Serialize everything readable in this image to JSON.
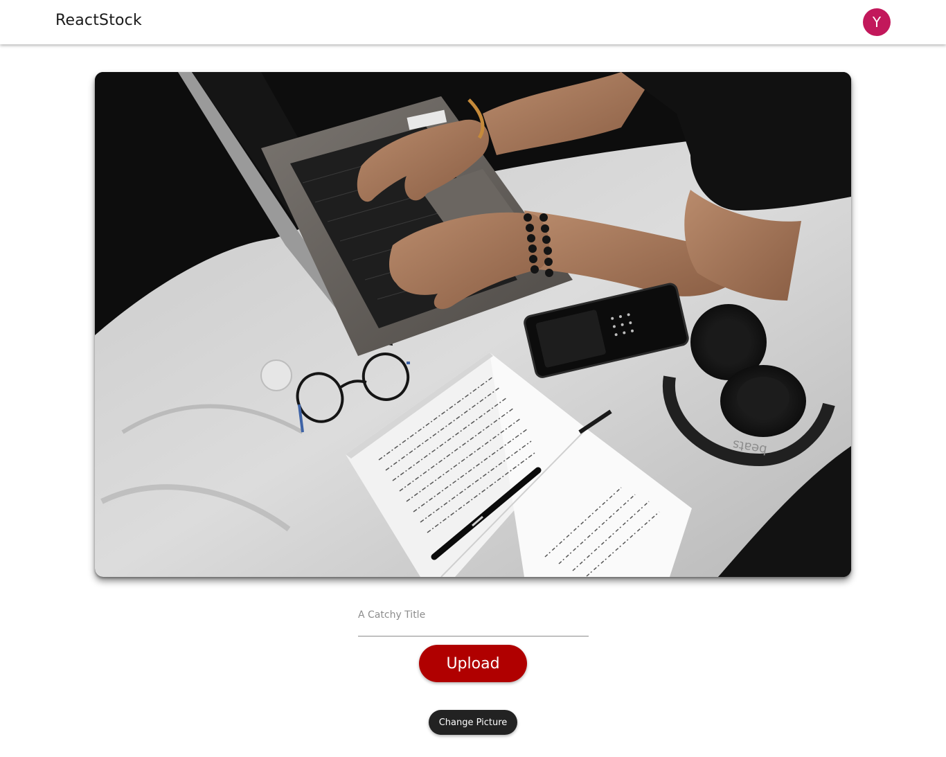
{
  "app": {
    "brand": "ReactStock"
  },
  "user": {
    "avatar_initial": "Y",
    "avatar_color": "#c2185b"
  },
  "photo": {
    "alt": "Person typing on a laptop on a bed with a notebook, glasses, phone and headphones",
    "headphone_brand": "beats"
  },
  "form": {
    "title_placeholder": "A Catchy Title",
    "title_value": "",
    "upload_label": "Upload",
    "upload_color": "#b00000",
    "change_picture_label": "Change Picture",
    "change_picture_color": "#222222"
  }
}
